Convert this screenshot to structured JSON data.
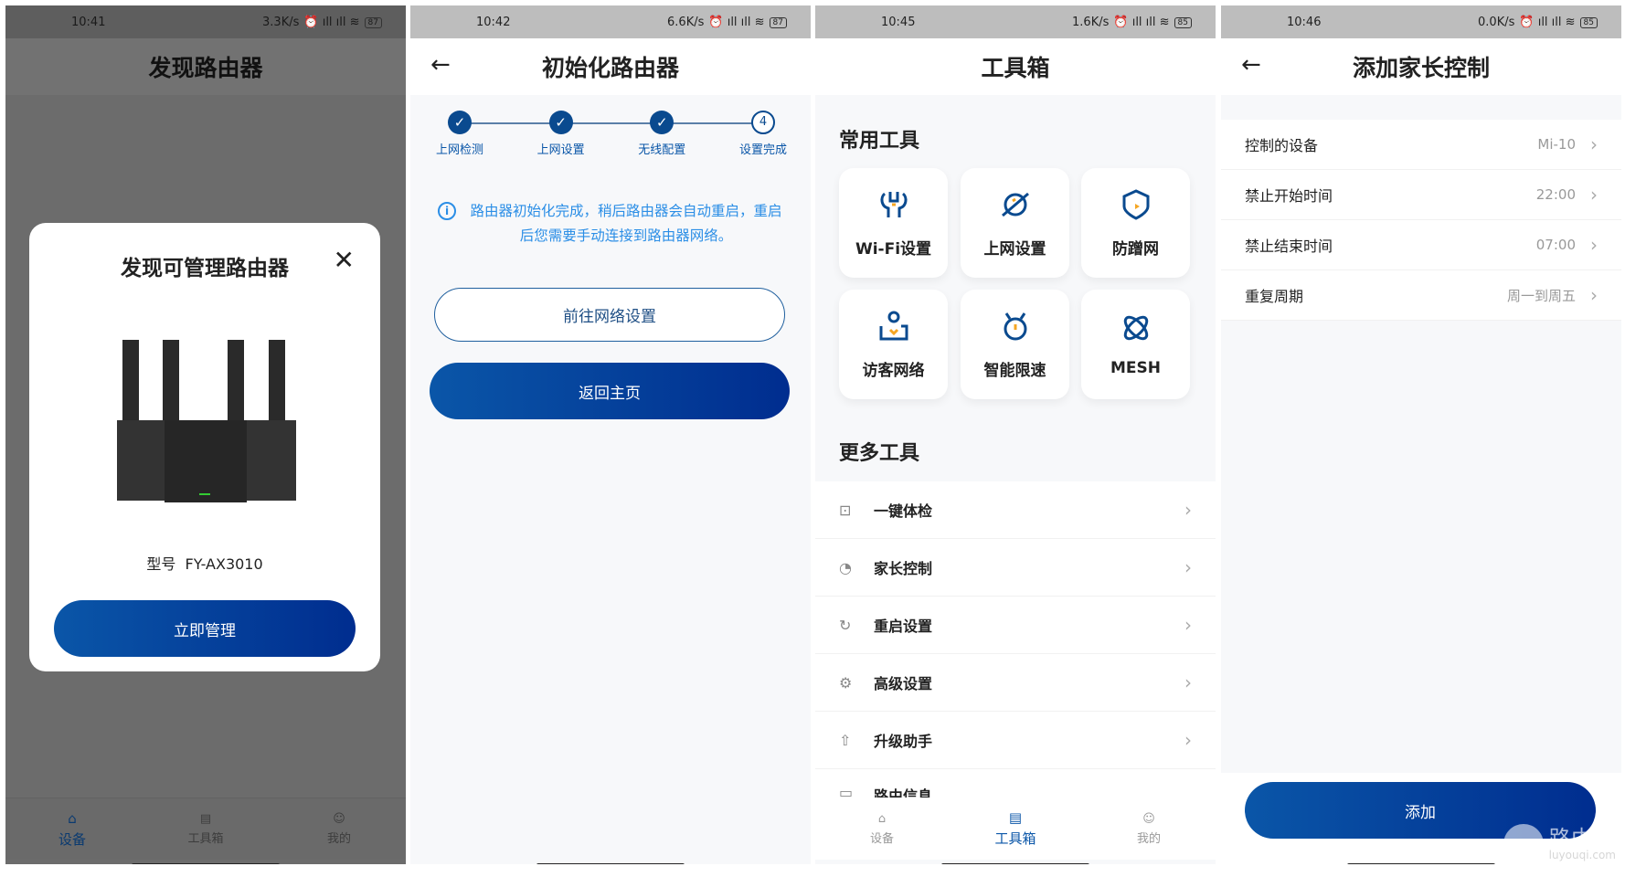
{
  "panels": [
    {
      "status": {
        "time": "10:41",
        "speed": "3.3K/s",
        "battery": "87"
      },
      "title": "发现路由器",
      "modal": {
        "title": "发现可管理路由器",
        "model_label": "型号",
        "model": "FY-AX3010",
        "button": "立即管理"
      },
      "nav": [
        {
          "label": "设备",
          "icon": "router-icon",
          "active": true
        },
        {
          "label": "工具箱",
          "icon": "toolbox-icon"
        },
        {
          "label": "我的",
          "icon": "user-icon"
        }
      ]
    },
    {
      "status": {
        "time": "10:42",
        "speed": "6.6K/s",
        "battery": "87"
      },
      "title": "初始化路由器",
      "steps": [
        {
          "label": "上网检测",
          "done": true
        },
        {
          "label": "上网设置",
          "done": true
        },
        {
          "label": "无线配置",
          "done": true
        },
        {
          "label": "设置完成",
          "number": "4",
          "done": false
        }
      ],
      "info": "路由器初始化完成，稍后路由器会自动重启，重启后您需要手动连接到路由器网络。",
      "btn_outline": "前往网络设置",
      "btn_fill": "返回主页"
    },
    {
      "status": {
        "time": "10:45",
        "speed": "1.6K/s",
        "battery": "85"
      },
      "title": "工具箱",
      "common_title": "常用工具",
      "tools": [
        {
          "label": "Wi-Fi设置",
          "icon": "wifi-tool-icon"
        },
        {
          "label": "上网设置",
          "icon": "planet-icon"
        },
        {
          "label": "防蹭网",
          "icon": "shield-icon"
        },
        {
          "label": "访客网络",
          "icon": "guest-icon"
        },
        {
          "label": "智能限速",
          "icon": "speed-limit-icon"
        },
        {
          "label": "MESH",
          "icon": "mesh-icon"
        }
      ],
      "more_title": "更多工具",
      "more": [
        {
          "label": "一键体检",
          "icon": "checkup-icon"
        },
        {
          "label": "家长控制",
          "icon": "parental-icon"
        },
        {
          "label": "重启设置",
          "icon": "restart-icon"
        },
        {
          "label": "高级设置",
          "icon": "gear-icon"
        },
        {
          "label": "升级助手",
          "icon": "upgrade-icon"
        },
        {
          "label": "路由信息",
          "icon": "info-icon"
        }
      ],
      "nav": [
        {
          "label": "设备",
          "icon": "router-icon"
        },
        {
          "label": "工具箱",
          "icon": "toolbox-icon",
          "active": true
        },
        {
          "label": "我的",
          "icon": "user-icon"
        }
      ]
    },
    {
      "status": {
        "time": "10:46",
        "speed": "0.0K/s",
        "battery": "85"
      },
      "title": "添加家长控制",
      "rows": [
        {
          "label": "控制的设备",
          "value": "Mi-10"
        },
        {
          "label": "禁止开始时间",
          "value": "22:00"
        },
        {
          "label": "禁止结束时间",
          "value": "07:00"
        },
        {
          "label": "重复周期",
          "value": "周一到周五"
        }
      ],
      "button": "添加"
    }
  ],
  "watermark": {
    "text": "路由器",
    "url": "luyouqi.com"
  },
  "colors": {
    "primary": "#0a56a8",
    "primary_dark": "#002d8f",
    "info": "#2b8ee6",
    "accent": "#f5a623"
  }
}
